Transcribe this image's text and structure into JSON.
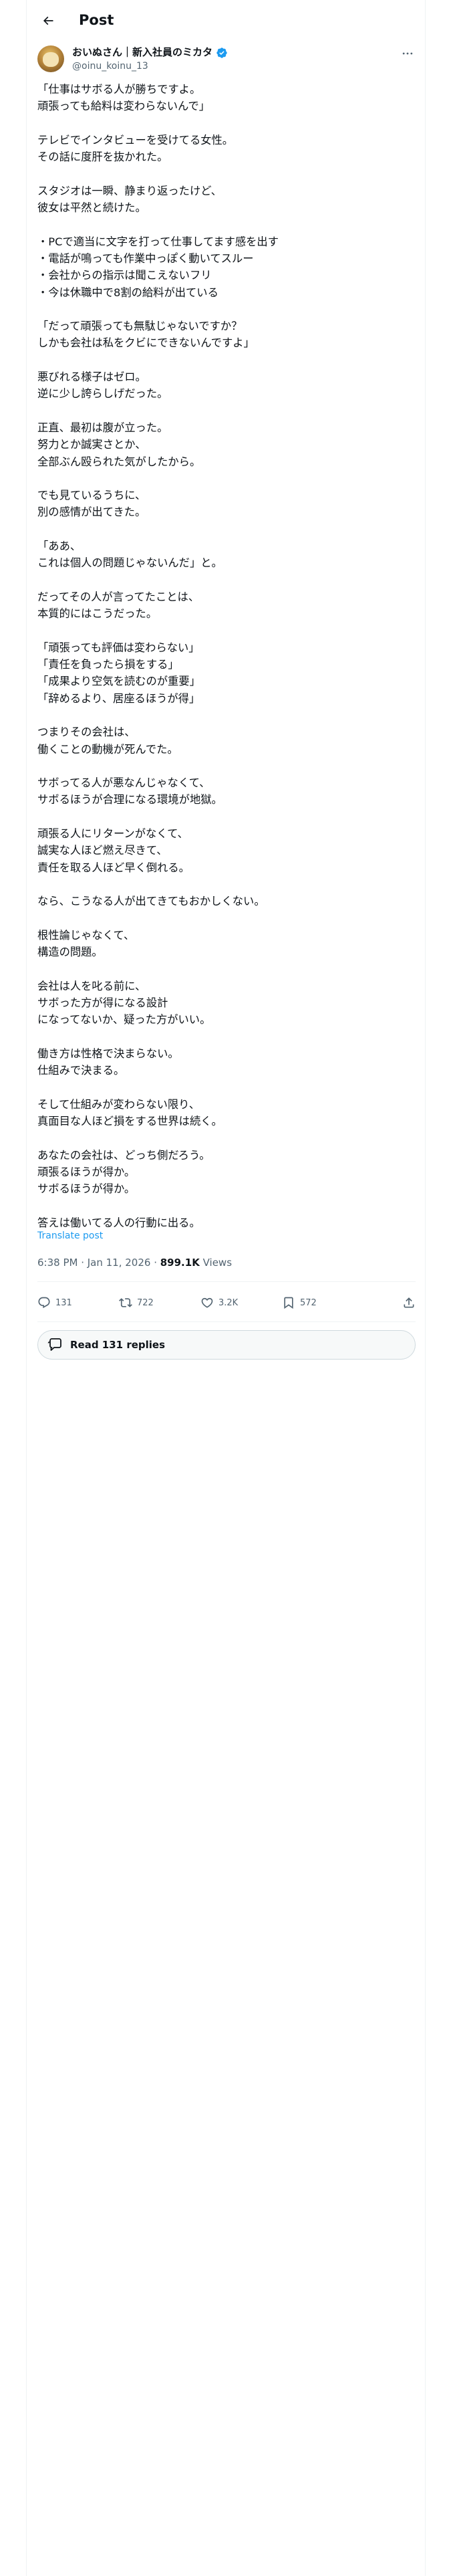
{
  "header": {
    "title": "Post"
  },
  "author": {
    "name": "おいぬさん｜新入社員のミカタ",
    "handle": "@oinu_koinu_13"
  },
  "post": {
    "text": "「仕事はサボる人が勝ちですよ。\n頑張っても給料は変わらないんで」\n\nテレビでインタビューを受けてる女性。\nその話に度肝を抜かれた。\n\nスタジオは一瞬、静まり返ったけど、\n彼女は平然と続けた。\n\n・PCで適当に文字を打って仕事してます感を出す\n・電話が鳴っても作業中っぽく動いてスルー\n・会社からの指示は聞こえないフリ\n・今は休職中で8割の給料が出ている\n\n「だって頑張っても無駄じゃないですか？\nしかも会社は私をクビにできないんですよ」\n\n悪びれる様子はゼロ。\n逆に少し誇らしげだった。\n\n正直、最初は腹が立った。\n努力とか誠実さとか、\n全部ぶん殴られた気がしたから。\n\nでも見ているうちに、\n別の感情が出てきた。\n\n「ああ、\nこれは個人の問題じゃないんだ」と。\n\nだってその人が言ってたことは、\n本質的にはこうだった。\n\n「頑張っても評価は変わらない」\n「責任を負ったら損をする」\n「成果より空気を読むのが重要」\n「辞めるより、居座るほうが得」\n\nつまりその会社は、\n働くことの動機が死んでた。\n\nサボってる人が悪なんじゃなくて、\nサボるほうが合理になる環境が地獄。\n\n頑張る人にリターンがなくて、\n誠実な人ほど燃え尽きて、\n責任を取る人ほど早く倒れる。\n\nなら、こうなる人が出てきてもおかしくない。\n\n根性論じゃなくて、\n構造の問題。\n\n会社は人を叱る前に、\nサボった方が得になる設計\nになってないか、疑った方がいい。\n\n働き方は性格で決まらない。\n仕組みで決まる。\n\nそして仕組みが変わらない限り、\n真面目な人ほど損をする世界は続く。\n\nあなたの会社は、どっち側だろう。\n頑張るほうが得か。\nサボるほうが得か。\n\n答えは働いてる人の行動に出る。",
    "translate_label": "Translate post",
    "time": "6:38 PM · Jan 11, 2026",
    "separator": " · ",
    "views_count": "899.1K",
    "views_label": " Views"
  },
  "actions": {
    "replies": "131",
    "reposts": "722",
    "likes": "3.2K",
    "bookmarks": "572"
  },
  "read_replies_label": "Read 131 replies",
  "colors": {
    "accent": "#1d9bf0",
    "secondary_text": "#536471",
    "border": "#eff3f4"
  },
  "icons": [
    "back-arrow-icon",
    "verified-badge-icon",
    "more-icon",
    "reply-icon",
    "repost-icon",
    "like-icon",
    "bookmark-icon",
    "share-icon",
    "speech-bubble-icon"
  ]
}
